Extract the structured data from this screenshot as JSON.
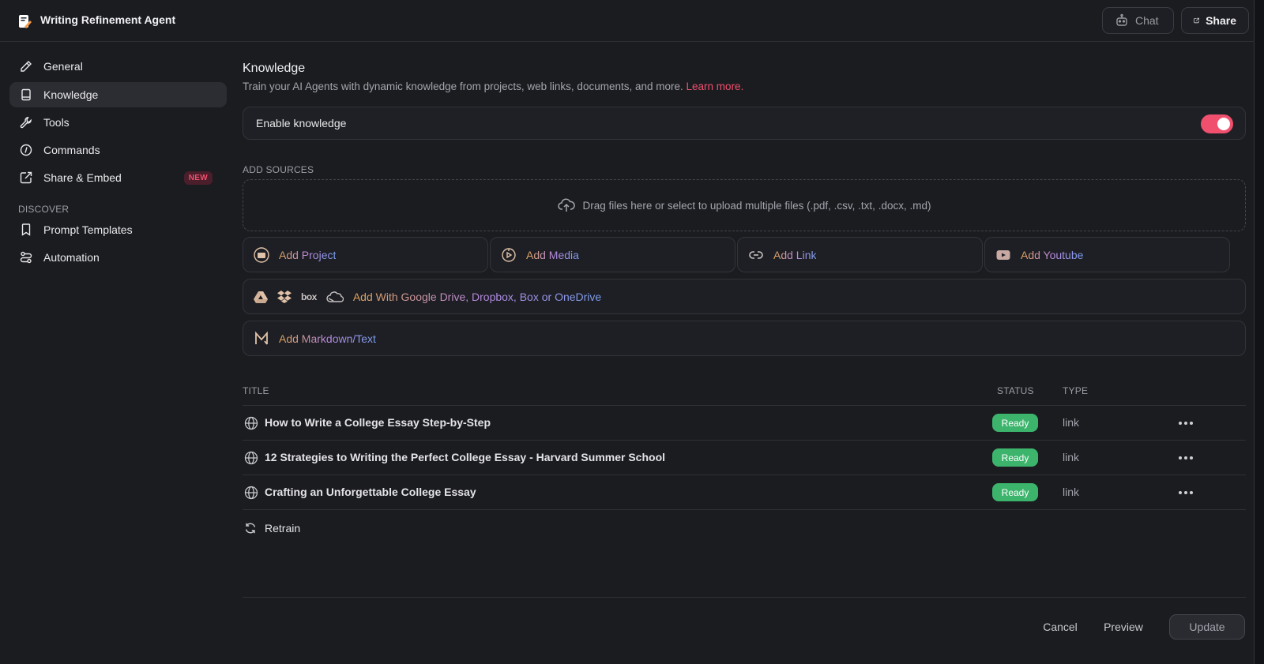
{
  "header": {
    "app_title": "Writing Refinement Agent",
    "chat_label": "Chat",
    "share_label": "Share"
  },
  "sidebar": {
    "items": [
      {
        "label": "General",
        "icon": "pencil-icon"
      },
      {
        "label": "Knowledge",
        "icon": "book-icon",
        "active": true
      },
      {
        "label": "Tools",
        "icon": "wrench-icon"
      },
      {
        "label": "Commands",
        "icon": "command-icon"
      },
      {
        "label": "Share & Embed",
        "icon": "share-embed-icon",
        "badge": "NEW"
      }
    ],
    "discover_label": "DISCOVER",
    "discover_items": [
      {
        "label": "Prompt Templates",
        "icon": "bookmark-icon"
      },
      {
        "label": "Automation",
        "icon": "automation-icon"
      }
    ]
  },
  "main": {
    "title": "Knowledge",
    "description": "Train your AI Agents with dynamic knowledge from projects, web links, documents, and more.",
    "learn_more": "Learn more.",
    "enable_label": "Enable knowledge",
    "enable_on": true,
    "add_sources_label": "ADD SOURCES",
    "dropzone_text": "Drag files here or select to upload multiple files (.pdf, .csv, .txt, .docx, .md)",
    "sources": [
      {
        "label": "Add Project",
        "icon": "project-icon"
      },
      {
        "label": "Add Media",
        "icon": "media-icon"
      },
      {
        "label": "Add Link",
        "icon": "link-icon"
      },
      {
        "label": "Add Youtube",
        "icon": "youtube-icon"
      }
    ],
    "cloud_label": "Add With Google Drive, Dropbox, Box or OneDrive",
    "cloud_box_text": "box",
    "markdown_label": "Add Markdown/Text"
  },
  "table": {
    "headers": {
      "title": "TITLE",
      "status": "STATUS",
      "type": "TYPE"
    },
    "rows": [
      {
        "title": "How to Write a College Essay Step-by-Step",
        "status": "Ready",
        "type": "link"
      },
      {
        "title": "12 Strategies to Writing the Perfect College Essay - Harvard Summer School",
        "status": "Ready",
        "type": "link"
      },
      {
        "title": "Crafting an Unforgettable College Essay",
        "status": "Ready",
        "type": "link"
      }
    ],
    "retrain_label": "Retrain"
  },
  "footer": {
    "cancel_label": "Cancel",
    "preview_label": "Preview",
    "update_label": "Update"
  },
  "colors": {
    "accent": "#f0506e",
    "status_ready": "#3cb46c",
    "background": "#1b1c20"
  }
}
